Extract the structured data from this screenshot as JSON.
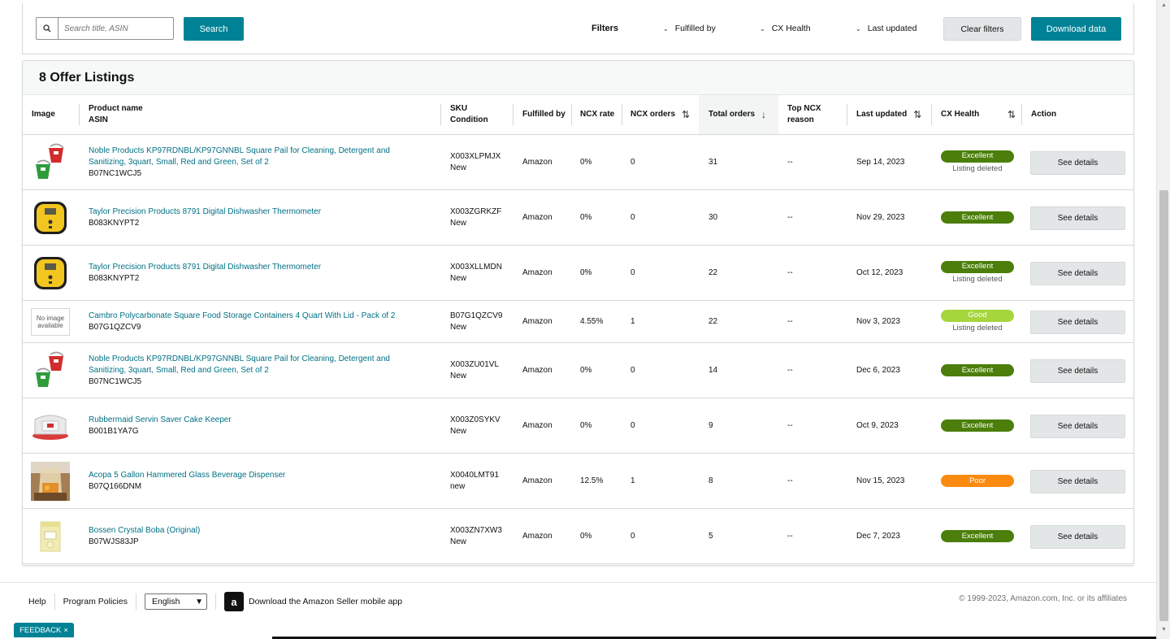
{
  "topbar": {
    "search_placeholder": "Search title, ASIN",
    "search_button": "Search",
    "filters_label": "Filters",
    "filter_fulfilled_by": "Fulfilled by",
    "filter_cx_health": "CX Health",
    "filter_last_updated": "Last updated",
    "clear_filters": "Clear filters",
    "download_data": "Download data"
  },
  "listing": {
    "title": "8 Offer Listings",
    "headers": {
      "image": "Image",
      "product_name": "Product name",
      "asin": "ASIN",
      "sku": "SKU",
      "condition": "Condition",
      "fulfilled_by": "Fulfilled by",
      "ncx_rate": "NCX rate",
      "ncx_orders": "NCX orders",
      "total_orders": "Total orders",
      "top_ncx_reason_1": "Top NCX",
      "top_ncx_reason_2": "reason",
      "last_updated": "Last updated",
      "cx_health": "CX Health",
      "action": "Action"
    },
    "rows": [
      {
        "image": "pail-icon",
        "name_line1": "Noble Products KP97RDNBL/KP97GNNBL Square Pail for Cleaning, Detergent and",
        "name_line2": "Sanitizing, 3quart, Small, Red and Green, Set of 2",
        "asin": "B07NC1WCJ5",
        "sku": "X003XLPMJX",
        "condition": "New",
        "fulfilled": "Amazon",
        "ncx_rate": "0%",
        "ncx_orders": "0",
        "total_orders": "31",
        "top_reason": "--",
        "updated": "Sep 14, 2023",
        "health": "Excellent",
        "health_color": "#4b7e0b",
        "deleted": "Listing deleted",
        "action": "See details"
      },
      {
        "image": "thermometer-icon",
        "name_line1": "Taylor Precision Products 8791 Digital Dishwasher Thermometer",
        "name_line2": "",
        "asin": "B083KNYPT2",
        "sku": "X003ZGRKZF",
        "condition": "New",
        "fulfilled": "Amazon",
        "ncx_rate": "0%",
        "ncx_orders": "0",
        "total_orders": "30",
        "top_reason": "--",
        "updated": "Nov 29, 2023",
        "health": "Excellent",
        "health_color": "#4b7e0b",
        "deleted": "",
        "action": "See details"
      },
      {
        "image": "thermometer-icon",
        "name_line1": "Taylor Precision Products 8791 Digital Dishwasher Thermometer",
        "name_line2": "",
        "asin": "B083KNYPT2",
        "sku": "X003XLLMDN",
        "condition": "New",
        "fulfilled": "Amazon",
        "ncx_rate": "0%",
        "ncx_orders": "0",
        "total_orders": "22",
        "top_reason": "--",
        "updated": "Oct 12, 2023",
        "health": "Excellent",
        "health_color": "#4b7e0b",
        "deleted": "Listing deleted",
        "action": "See details"
      },
      {
        "image": "no-image-placeholder",
        "name_line1": "Cambro Polycarbonate Square Food Storage Containers 4 Quart With Lid - Pack of 2",
        "name_line2": "",
        "asin": "B07G1QZCV9",
        "sku": "B07G1QZCV9",
        "condition": "New",
        "fulfilled": "Amazon",
        "ncx_rate": "4.55%",
        "ncx_orders": "1",
        "total_orders": "22",
        "top_reason": "--",
        "updated": "Nov 3, 2023",
        "health": "Good",
        "health_color": "#a5d63c",
        "deleted": "Listing deleted",
        "action": "See details"
      },
      {
        "image": "pail-icon",
        "name_line1": "Noble Products KP97RDNBL/KP97GNNBL Square Pail for Cleaning, Detergent and",
        "name_line2": "Sanitizing, 3quart, Small, Red and Green, Set of 2",
        "asin": "B07NC1WCJ5",
        "sku": "X003ZU01VL",
        "condition": "New",
        "fulfilled": "Amazon",
        "ncx_rate": "0%",
        "ncx_orders": "0",
        "total_orders": "14",
        "top_reason": "--",
        "updated": "Dec 6, 2023",
        "health": "Excellent",
        "health_color": "#4b7e0b",
        "deleted": "",
        "action": "See details"
      },
      {
        "image": "cake-keeper-icon",
        "name_line1": "Rubbermaid Servin Saver Cake Keeper",
        "name_line2": "",
        "asin": "B001B1YA7G",
        "sku": "X003Z0SYKV",
        "condition": "New",
        "fulfilled": "Amazon",
        "ncx_rate": "0%",
        "ncx_orders": "0",
        "total_orders": "9",
        "top_reason": "--",
        "updated": "Oct 9, 2023",
        "health": "Excellent",
        "health_color": "#4b7e0b",
        "deleted": "",
        "action": "See details"
      },
      {
        "image": "beverage-dispenser-icon",
        "name_line1": "Acopa 5 Gallon Hammered Glass Beverage Dispenser",
        "name_line2": "",
        "asin": "B07Q166DNM",
        "sku": "X0040LMT91",
        "condition": "new",
        "fulfilled": "Amazon",
        "ncx_rate": "12.5%",
        "ncx_orders": "1",
        "total_orders": "8",
        "top_reason": "--",
        "updated": "Nov 15, 2023",
        "health": "Poor",
        "health_color": "#fa8a10",
        "deleted": "",
        "action": "See details"
      },
      {
        "image": "boba-bag-icon",
        "name_line1": "Bossen Crystal Boba (Original)",
        "name_line2": "",
        "asin": "B07WJS83JP",
        "sku": "X003ZN7XW3",
        "condition": "New",
        "fulfilled": "Amazon",
        "ncx_rate": "0%",
        "ncx_orders": "0",
        "total_orders": "5",
        "top_reason": "--",
        "updated": "Dec 7, 2023",
        "health": "Excellent",
        "health_color": "#4b7e0b",
        "deleted": "",
        "action": "See details"
      }
    ]
  },
  "footer": {
    "help": "Help",
    "policies": "Program Policies",
    "language": "English",
    "app_link": "Download the Amazon Seller mobile app",
    "copyright": "© 1999-2023, Amazon.com, Inc. or its affiliates",
    "feedback": "FEEDBACK"
  },
  "no_image_text": [
    "No image",
    "available"
  ]
}
